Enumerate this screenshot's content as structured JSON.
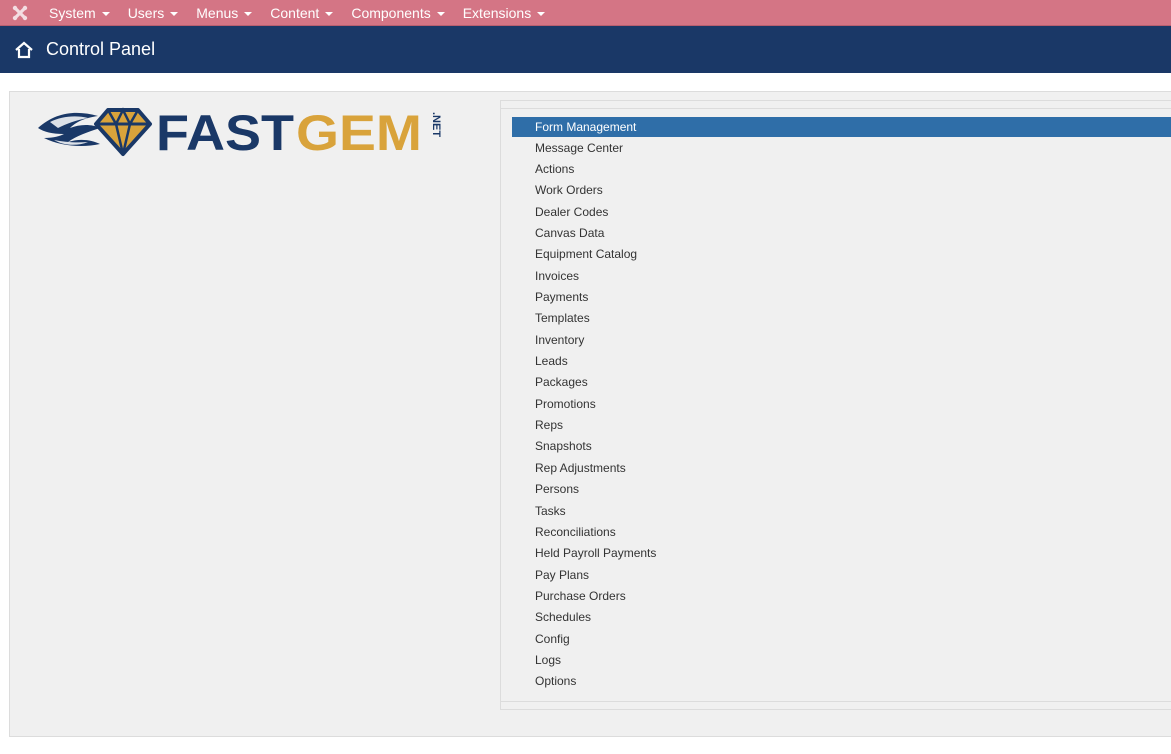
{
  "topbar": {
    "brand_icon": "joomla-icon",
    "menu": [
      {
        "label": "System"
      },
      {
        "label": "Users"
      },
      {
        "label": "Menus"
      },
      {
        "label": "Content"
      },
      {
        "label": "Components"
      },
      {
        "label": "Extensions"
      }
    ]
  },
  "header": {
    "icon": "home-icon",
    "title": "Control Panel"
  },
  "logo": {
    "text_part1": "FAST",
    "text_part2": "GEM",
    "suffix": ".NET",
    "colors": {
      "navy": "#1a3867",
      "gold": "#d9a33b"
    }
  },
  "sidebar_menu": {
    "active_index": 0,
    "items": [
      "Form Management",
      "Message Center",
      "Actions",
      "Work Orders",
      "Dealer Codes",
      "Canvas Data",
      "Equipment Catalog",
      "Invoices",
      "Payments",
      "Templates",
      "Inventory",
      "Leads",
      "Packages",
      "Promotions",
      "Reps",
      "Snapshots",
      "Rep Adjustments",
      "Persons",
      "Tasks",
      "Reconciliations",
      "Held Payroll Payments",
      "Pay Plans",
      "Purchase Orders",
      "Schedules",
      "Config",
      "Logs",
      "Options"
    ]
  },
  "colors": {
    "topbar": "#d47585",
    "header": "#1a3867",
    "active_item": "#2f6ea8"
  }
}
